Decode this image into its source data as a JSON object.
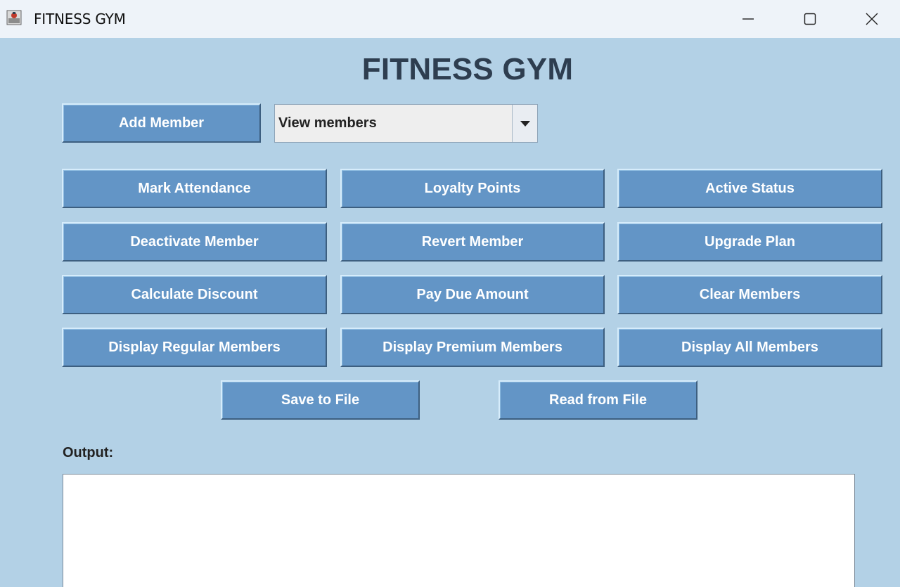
{
  "window": {
    "title": "FITNESS GYM",
    "controls": [
      "minimize-icon",
      "maximize-icon",
      "close-icon"
    ]
  },
  "heading": "FITNESS GYM",
  "top_row": {
    "add_member": "Add Member",
    "view_combo": {
      "selected": "View members"
    }
  },
  "actions": {
    "mark_attendance": "Mark Attendance",
    "loyalty_points": "Loyalty Points",
    "active_status": "Active Status",
    "deactivate_member": "Deactivate Member",
    "revert_member": "Revert Member",
    "upgrade_plan": "Upgrade Plan",
    "calculate_discount": "Calculate Discount",
    "pay_due_amount": "Pay Due Amount",
    "clear_members": "Clear Members",
    "display_regular": "Display Regular Members",
    "display_premium": "Display Premium Members",
    "display_all": "Display All Members"
  },
  "file": {
    "save": "Save to File",
    "read": "Read from File"
  },
  "output": {
    "label": "Output:",
    "text": ""
  },
  "colors": {
    "background": "#b3d1e6",
    "button": "#6395c6",
    "button_text": "#ffffff",
    "heading": "#2e3e50"
  }
}
